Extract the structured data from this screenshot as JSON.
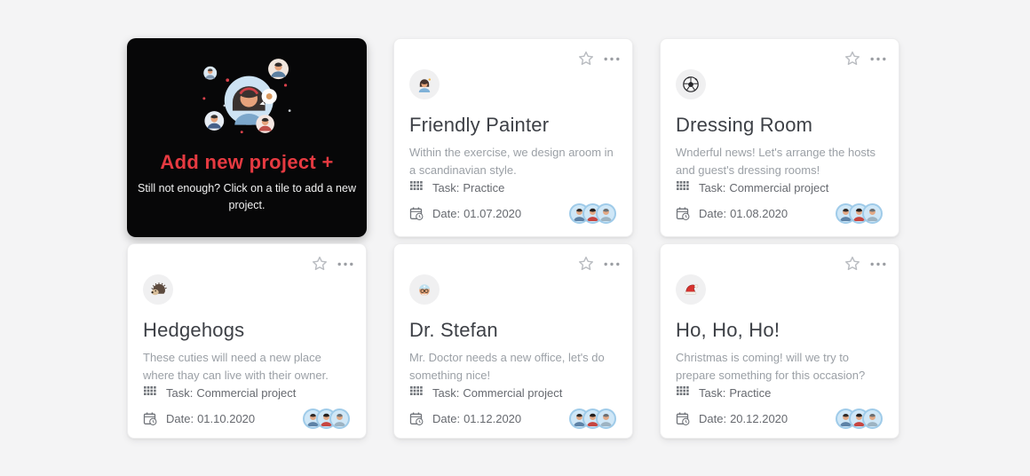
{
  "page": {
    "background": "#f4f4f5"
  },
  "add_card": {
    "title": "Add new project +",
    "title_color": "#e63a41",
    "subtitle": "Still not enough? Click on a tile to add a new project.",
    "illustration": "team-avatars-illustration"
  },
  "card_chrome": {
    "favorite_icon": "star-outline",
    "menu_icon": "horizontal-ellipsis",
    "task_icon": "grid",
    "date_icon": "calendar-clock",
    "team_avatar_count": 3
  },
  "cards": [
    {
      "icon": "woman-artist-avatar",
      "title": "Friendly Painter",
      "description": "Within the exercise, we design aroom in a scandinavian style.",
      "task_label": "Task:",
      "task_value": "Practice",
      "date_label": "Date:",
      "date_value": "01.07.2020"
    },
    {
      "icon": "soccer-ball-avatar",
      "title": "Dressing Room",
      "description": "Wnderful news! Let's arrange the hosts and guest's dressing rooms!",
      "task_label": "Task:",
      "task_value": "Commercial project",
      "date_label": "Date:",
      "date_value": "01.08.2020"
    },
    {
      "icon": "hedgehog-avatar",
      "title": "Hedgehogs",
      "description": "These cuties will need a new place where thay can live with their owner.",
      "task_label": "Task:",
      "task_value": "Commercial project",
      "date_label": "Date:",
      "date_value": "01.10.2020"
    },
    {
      "icon": "doctor-avatar",
      "title": "Dr. Stefan",
      "description": "Mr. Doctor needs a new office, let's do something nice!",
      "task_label": "Task:",
      "task_value": "Commercial project",
      "date_label": "Date:",
      "date_value": "01.12.2020"
    },
    {
      "icon": "santa-hat-avatar",
      "title": "Ho, Ho, Ho!",
      "description": "Christmas is coming! will we try to prepare something for this occasion?",
      "task_label": "Task:",
      "task_value": "Practice",
      "date_label": "Date:",
      "date_value": "20.12.2020"
    }
  ]
}
